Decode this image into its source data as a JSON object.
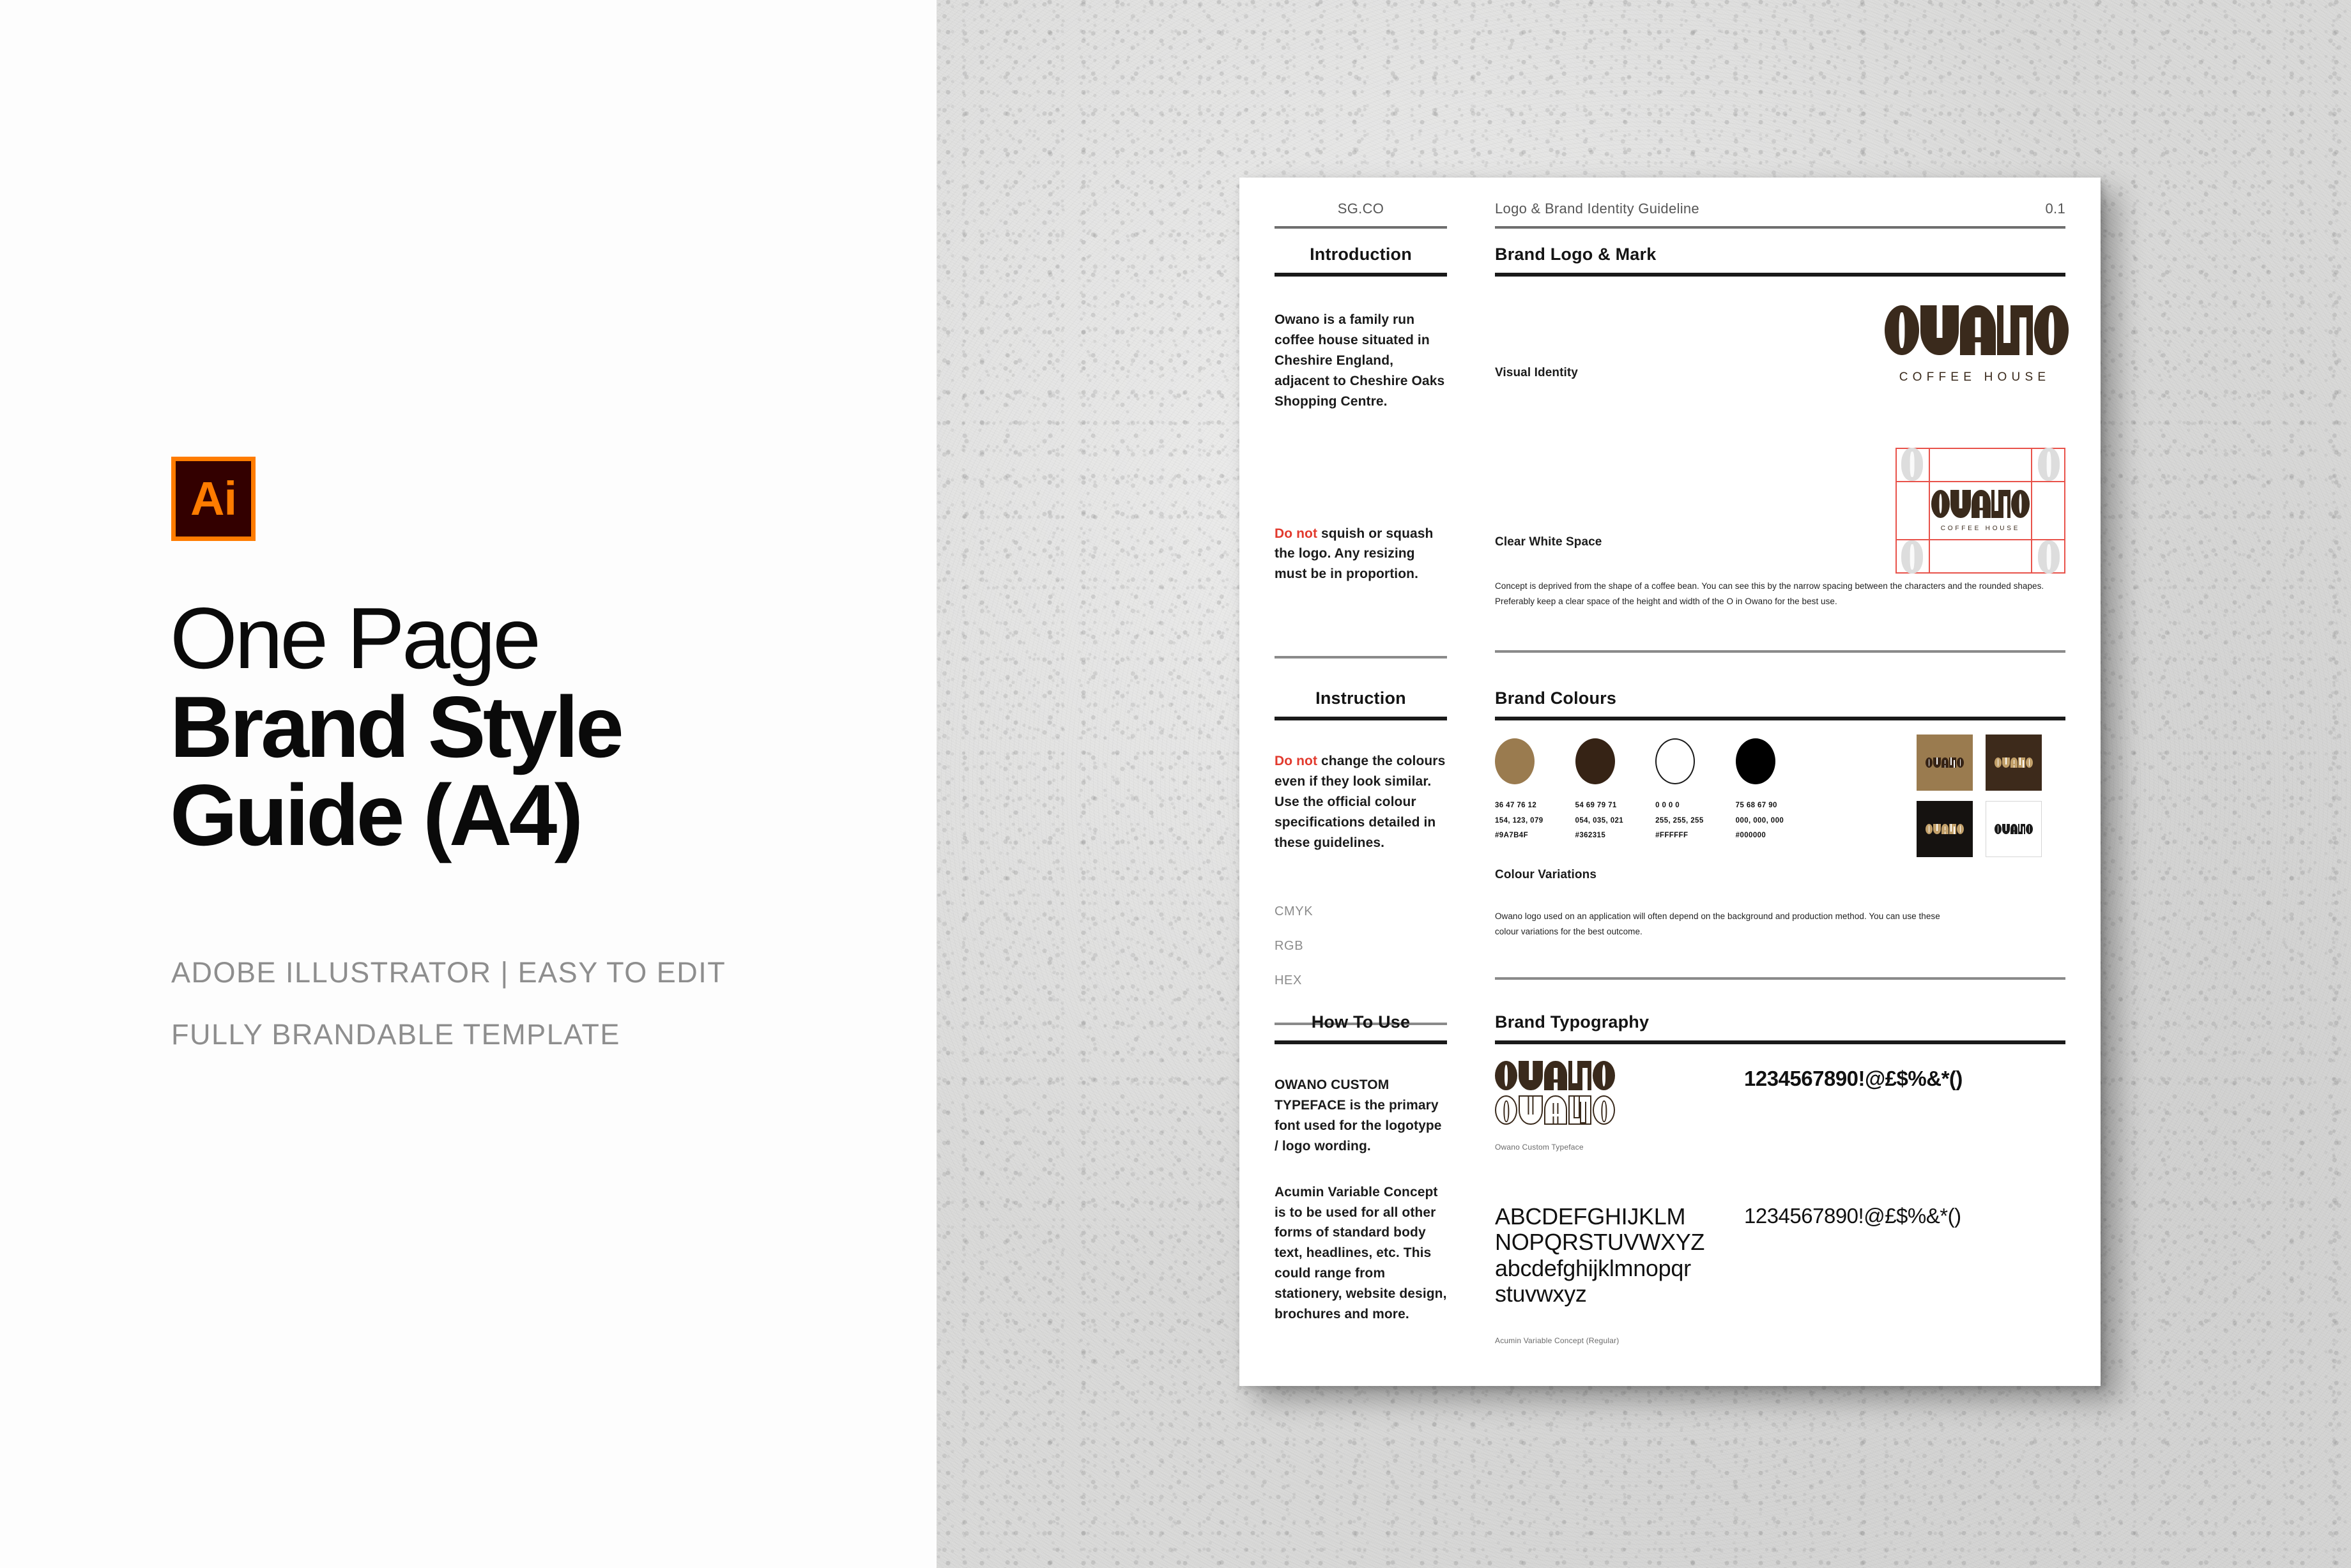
{
  "promo": {
    "badge_label": "Ai",
    "title_line1": "One Page",
    "title_line2": "Brand Style",
    "title_line3": "Guide (A4)",
    "subtitle_line1": "ADOBE ILLUSTRATOR | EASY TO EDIT",
    "subtitle_line2": "FULLY BRANDABLE TEMPLATE",
    "accent_color": "#ff7c00",
    "badge_bg": "#330000"
  },
  "page": {
    "header": {
      "brand": "SG.CO",
      "doc_title": "Logo & Brand Identity Guideline",
      "page_number": "0.1"
    },
    "sections": {
      "introduction": {
        "heading": "Introduction",
        "body": "Owano is a family run coffee house situated in Cheshire England, adjacent to Cheshire Oaks Shopping Centre.",
        "warning_prefix": "Do not",
        "warning_body": " squish or squash the logo. Any resizing must be in proportion."
      },
      "instruction": {
        "heading": "Instruction",
        "warning_prefix": "Do not",
        "warning_body": " change the colours even if they look similar. Use the official colour specifications detailed in these guidelines.",
        "spec_labels": [
          "CMYK",
          "RGB",
          "HEX"
        ]
      },
      "how_to_use": {
        "heading": "How To Use",
        "para1": "OWANO CUSTOM TYPEFACE is the primary font used for the logotype / logo wording.",
        "para2": "Acumin Variable Concept is to be used for all other forms of standard body text, headlines, etc. This could range from stationery, website design, brochures and more."
      },
      "brand_logo": {
        "heading": "Brand Logo & Mark",
        "visual_identity_label": "Visual Identity",
        "logo_wordmark": "OWANO",
        "logo_tagline": "COFFEE HOUSE",
        "clear_white_space_label": "Clear White Space",
        "clear_space_note": "Concept is deprived from the shape of a coffee bean. You can see this by the narrow spacing between the characters and the rounded shapes. Preferably keep a clear space of the height and width of the O in Owano for the best use.",
        "logo_color": "#3a2a1c",
        "guide_color": "#e8524a"
      },
      "brand_colours": {
        "heading": "Brand Colours",
        "swatches": [
          {
            "name": "tan",
            "hex": "#9A7B4F",
            "cmyk": "36  47  76  12",
            "rgb": "154, 123, 079",
            "hex_label": "#9A7B4F",
            "filled": true
          },
          {
            "name": "brown",
            "hex": "#362315",
            "cmyk": "54  69  79  71",
            "rgb": "054, 035, 021",
            "hex_label": "#362315",
            "filled": true
          },
          {
            "name": "white",
            "hex": "#FFFFFF",
            "cmyk": "0   0   0   0",
            "rgb": "255, 255, 255",
            "hex_label": "#FFFFFF",
            "filled": false
          },
          {
            "name": "black",
            "hex": "#000000",
            "cmyk": "75  68  67  90",
            "rgb": "000, 000, 000",
            "hex_label": "#000000",
            "filled": true
          }
        ],
        "variations_label": "Colour Variations",
        "variations_note": "Owano logo used on an application will often depend on the background and production method. You can use these colour variations for the best outcome.",
        "variation_tiles": [
          {
            "bg": "#9A7B4F",
            "fg": "#362315",
            "bordered": false
          },
          {
            "bg": "#3D2A1B",
            "fg": "#C2A06A",
            "bordered": false
          },
          {
            "bg": "#151210",
            "fg": "#C2A06A",
            "bordered": false
          },
          {
            "bg": "#FFFFFF",
            "fg": "#1a1a1a",
            "bordered": true
          }
        ],
        "tile_wordmark": "OWANO"
      },
      "brand_typography": {
        "heading": "Brand Typography",
        "custom_wordmark": "OWANO",
        "custom_caption": "Owano Custom Typeface",
        "custom_glyphs": "1234567890!@£$%&*()",
        "secondary_uppercase_1": "ABCDEFGHIJKLM",
        "secondary_uppercase_2": "NOPQRSTUVWXYZ",
        "secondary_lowercase_1": "abcdefghijklmnopqr",
        "secondary_lowercase_2": "stuvwxyz",
        "secondary_glyphs": "1234567890!@£$%&*()",
        "secondary_caption": "Acumin Variable Concept (Regular)"
      }
    }
  }
}
